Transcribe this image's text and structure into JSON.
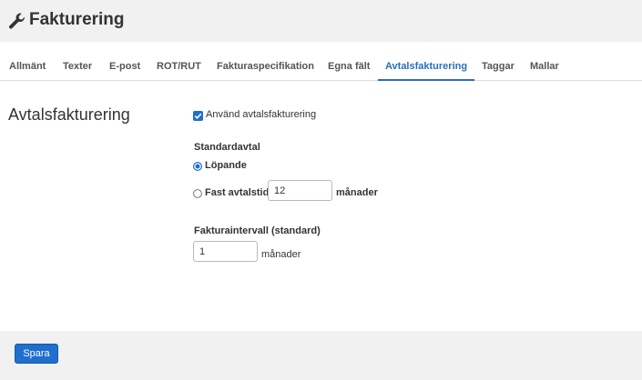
{
  "header": {
    "title": "Fakturering",
    "icon": "wrench-icon"
  },
  "tabs": [
    {
      "label": "Allmänt"
    },
    {
      "label": "Texter"
    },
    {
      "label": "E-post"
    },
    {
      "label": "ROT/RUT"
    },
    {
      "label": "Fakturaspecifikation"
    },
    {
      "label": "Egna fält"
    },
    {
      "label": "Avtalsfakturering",
      "active": true
    },
    {
      "label": "Taggar"
    },
    {
      "label": "Mallar"
    }
  ],
  "section": {
    "title": "Avtalsfakturering"
  },
  "form": {
    "use_label": "Använd avtalsfakturering",
    "use_checked": true,
    "default_agreement_label": "Standardavtal",
    "radio_ongoing_label": "Löpande",
    "radio_ongoing_selected": true,
    "radio_fixed_label": "Fast avtalstid",
    "fixed_value": "12",
    "fixed_unit": "månader",
    "interval_label": "Fakturaintervall (standard)",
    "interval_value": "1",
    "interval_unit": "månader"
  },
  "footer": {
    "save_label": "Spara"
  },
  "colors": {
    "accent": "#2a6ebb",
    "button": "#1f6fce",
    "header_bg": "#f1f1f1"
  }
}
